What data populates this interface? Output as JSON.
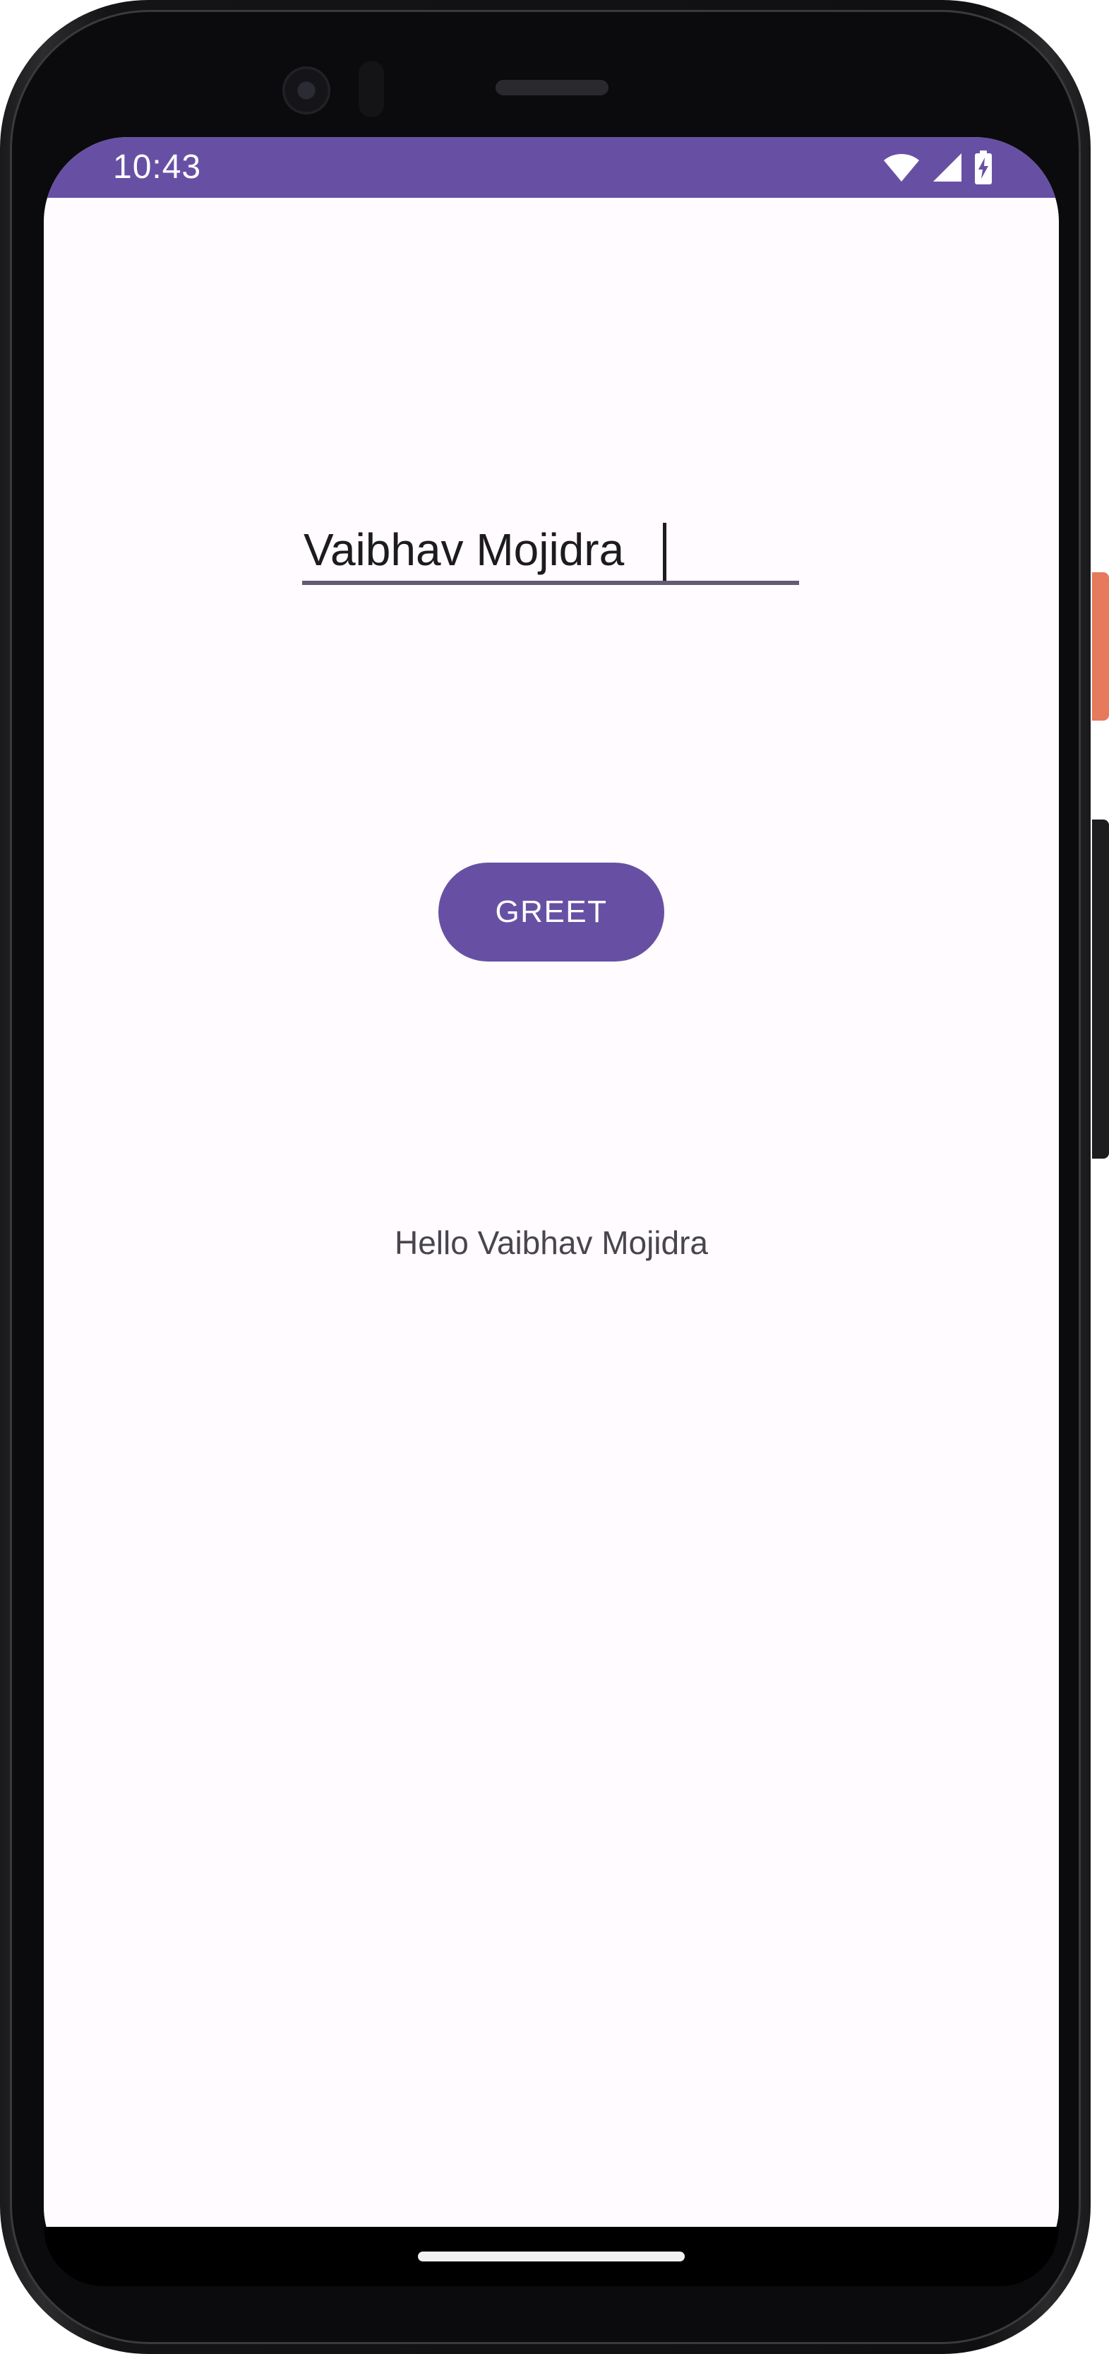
{
  "status_bar": {
    "time": "10:43",
    "icons": [
      "wifi-icon",
      "cellular-signal-icon",
      "battery-charging-icon"
    ],
    "color": "#6750a4"
  },
  "name_field": {
    "value": "Vaibhav Mojidra",
    "underline_color": "#625b71"
  },
  "greet_button": {
    "label": "GREET",
    "color": "#6750a4"
  },
  "greeting": {
    "text": "Hello Vaibhav Mojidra"
  },
  "theme": {
    "background": "#fffbfe",
    "text": "#1c1b1f"
  }
}
